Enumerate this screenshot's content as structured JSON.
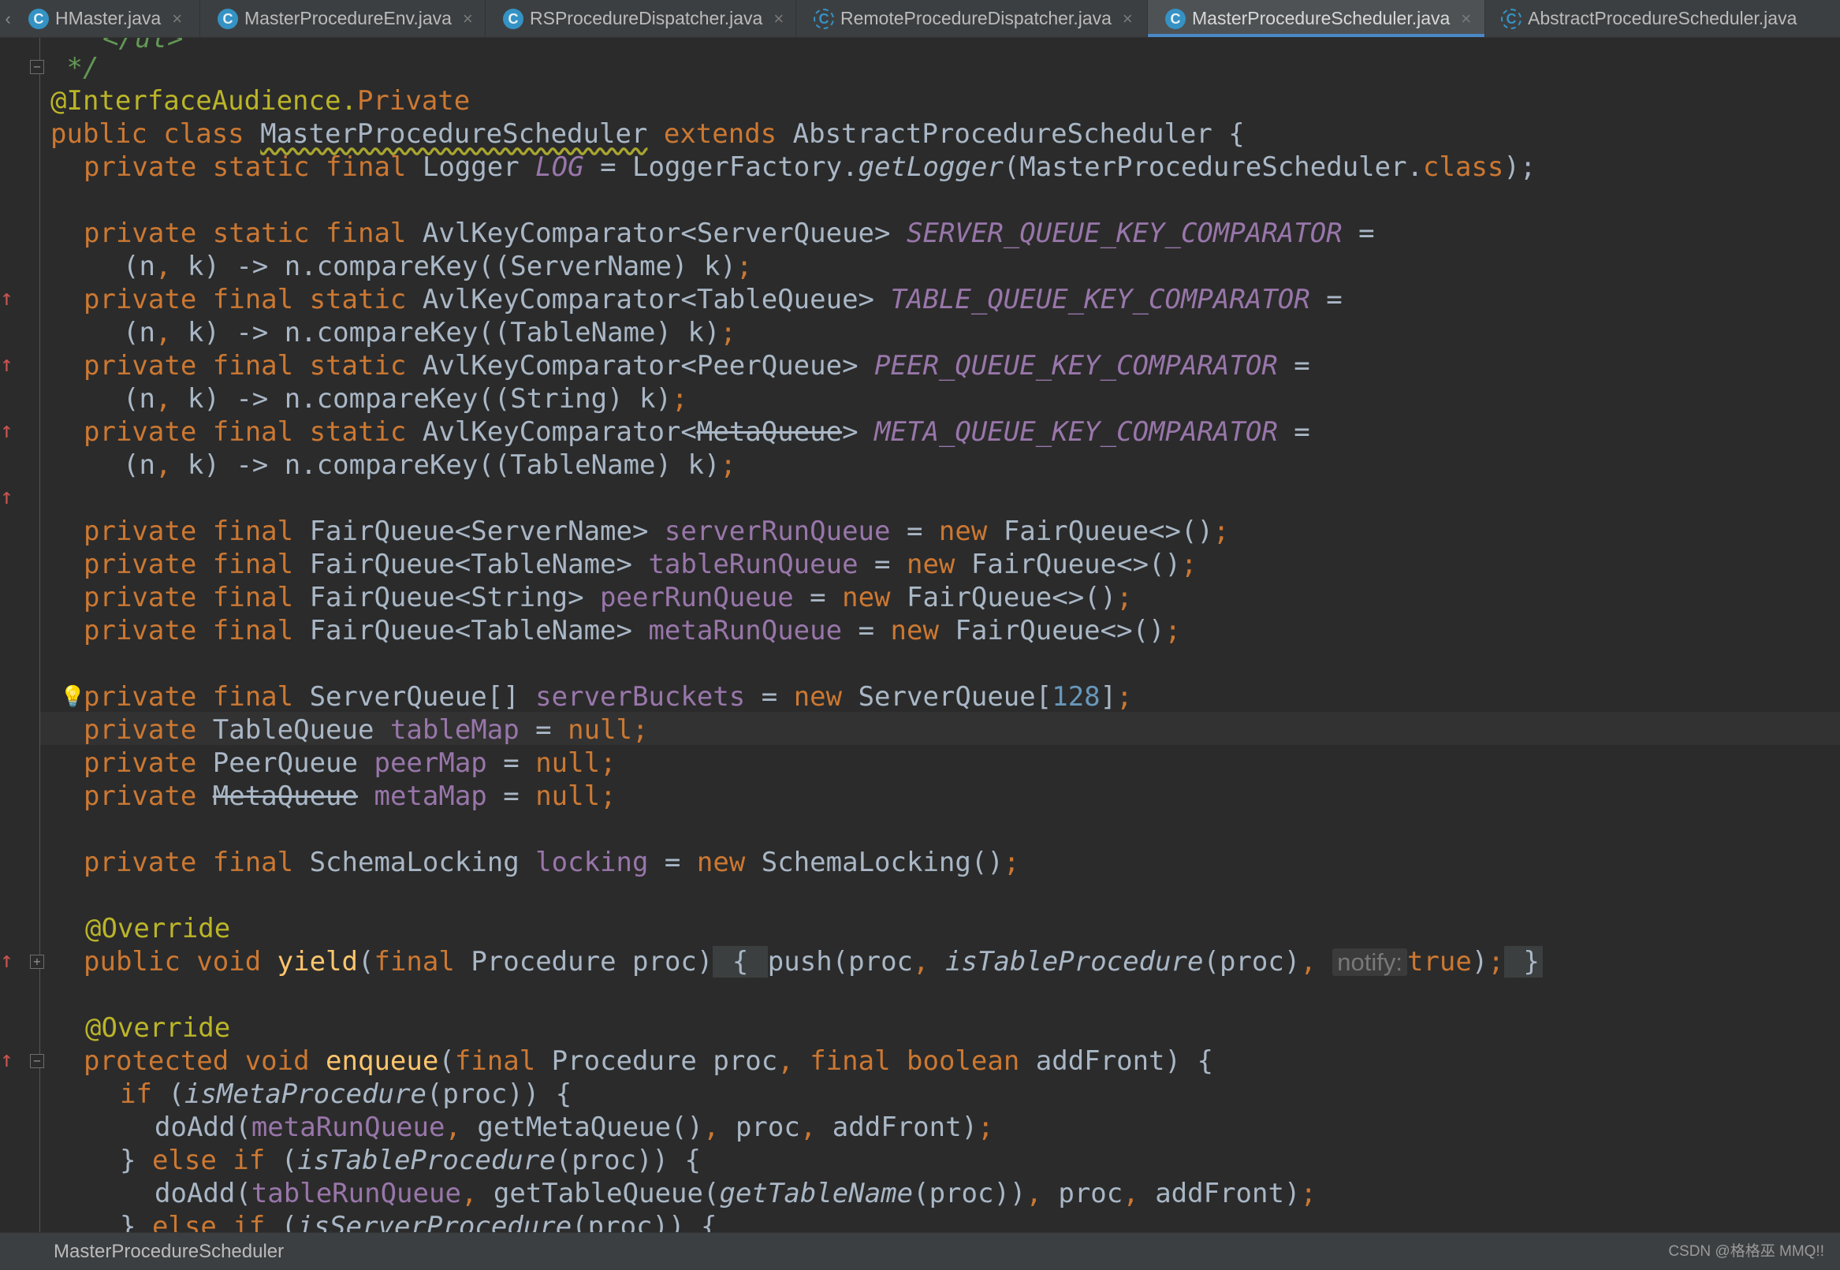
{
  "tabs": [
    {
      "label": "HMaster.java",
      "icon": "class-icon",
      "active": false
    },
    {
      "label": "MasterProcedureEnv.java",
      "icon": "class-icon",
      "active": false
    },
    {
      "label": "RSProcedureDispatcher.java",
      "icon": "class-icon",
      "active": false
    },
    {
      "label": "RemoteProcedureDispatcher.java",
      "icon": "abstract-class-icon",
      "active": false
    },
    {
      "label": "MasterProcedureScheduler.java",
      "icon": "class-icon",
      "active": true
    },
    {
      "label": "AbstractProcedureScheduler.java",
      "icon": "abstract-class-icon",
      "active": false
    }
  ],
  "tab_glyphs": {
    "class": "C",
    "close": "×",
    "edge": "‹"
  },
  "code": {
    "l0": {
      "t1": "</ul>"
    },
    "l1": {
      "t1": " */"
    },
    "l2": {
      "t1": "@InterfaceAudience.",
      "t2": "Private"
    },
    "l3": {
      "t1": "public class ",
      "t2": "MasterProcedureScheduler",
      "t3": " extends ",
      "t4": "AbstractProcedureScheduler {"
    },
    "l4": {
      "t1": "private static final ",
      "t2": "Logger ",
      "t3": "LOG",
      "t4": " = LoggerFactory.",
      "t5": "getLogger",
      "t6": "(MasterProcedureScheduler.",
      "t7": "class",
      "t8": ");"
    },
    "l6": {
      "t1": "private static final ",
      "t2": "AvlKeyComparator<ServerQueue> ",
      "t3": "SERVER_QUEUE_KEY_COMPARATOR",
      "t4": " ="
    },
    "l7": {
      "t1": "(n",
      "t2": ", ",
      "t3": "k) -> n.compareKey((ServerName) k)",
      "t4": ";"
    },
    "l8": {
      "t1": "private final static ",
      "t2": "AvlKeyComparator<TableQueue> ",
      "t3": "TABLE_QUEUE_KEY_COMPARATOR",
      "t4": " ="
    },
    "l9": {
      "t1": "(n",
      "t2": ", ",
      "t3": "k) -> n.compareKey((TableName) k)",
      "t4": ";"
    },
    "l10": {
      "t1": "private final static ",
      "t2": "AvlKeyComparator<PeerQueue> ",
      "t3": "PEER_QUEUE_KEY_COMPARATOR",
      "t4": " ="
    },
    "l11": {
      "t1": "(n",
      "t2": ", ",
      "t3": "k) -> n.compareKey((String) k)",
      "t4": ";"
    },
    "l12": {
      "t1": "private final static ",
      "t2": "AvlKeyComparator<",
      "t3": "MetaQueue",
      "t4": "> ",
      "t5": "META_QUEUE_KEY_COMPARATOR",
      "t6": " ="
    },
    "l13": {
      "t1": "(n",
      "t2": ", ",
      "t3": "k) -> n.compareKey((TableName) k)",
      "t4": ";"
    },
    "l15": {
      "t1": "private final ",
      "t2": "FairQueue<ServerName> ",
      "t3": "serverRunQueue",
      "t4": " = ",
      "t5": "new ",
      "t6": "FairQueue<>()",
      "t7": ";"
    },
    "l16": {
      "t1": "private final ",
      "t2": "FairQueue<TableName> ",
      "t3": "tableRunQueue",
      "t4": " = ",
      "t5": "new ",
      "t6": "FairQueue<>()",
      "t7": ";"
    },
    "l17": {
      "t1": "private final ",
      "t2": "FairQueue<String> ",
      "t3": "peerRunQueue",
      "t4": " = ",
      "t5": "new ",
      "t6": "FairQueue<>()",
      "t7": ";"
    },
    "l18": {
      "t1": "private final ",
      "t2": "FairQueue<TableName> ",
      "t3": "metaRunQueue",
      "t4": " = ",
      "t5": "new ",
      "t6": "FairQueue<>()",
      "t7": ";"
    },
    "l20": {
      "t1": "private final ",
      "t2": "ServerQueue[] ",
      "t3": "serverBuckets",
      "t4": " = ",
      "t5": "new ",
      "t6": "ServerQueue[",
      "t7": "128",
      "t8": "]",
      "t9": ";"
    },
    "l21": {
      "t1": "private ",
      "t2": "TableQueue ",
      "t3": "tableMap",
      "t4": " = ",
      "t5": "null;"
    },
    "l22": {
      "t1": "private ",
      "t2": "PeerQueue ",
      "t3": "peerMap",
      "t4": " = ",
      "t5": "null;"
    },
    "l23": {
      "t1": "private ",
      "t2": "MetaQueue",
      "t3": " ",
      "t4": "metaMap",
      "t5": " = ",
      "t6": "null;"
    },
    "l25": {
      "t1": "private final ",
      "t2": "SchemaLocking ",
      "t3": "locking",
      "t4": " = ",
      "t5": "new ",
      "t6": "SchemaLocking()",
      "t7": ";"
    },
    "l27": {
      "t1": "@Override"
    },
    "l28": {
      "t1": "public void ",
      "t2": "yield",
      "t3": "(",
      "t4": "final ",
      "t5": "Procedure proc)",
      "t6": " { ",
      "t7": "push(proc",
      "t8": ", ",
      "t9": "isTableProcedure",
      "t10": "(proc)",
      "t11": ", ",
      "t12": "notify:",
      "t13": "true",
      "t14": ")",
      "t15": ";",
      "t16": " }"
    },
    "l30": {
      "t1": "@Override"
    },
    "l31": {
      "t1": "protected void ",
      "t2": "enqueue",
      "t3": "(",
      "t4": "final ",
      "t5": "Procedure proc",
      "t6": ", ",
      "t7": "final boolean ",
      "t8": "addFront) {"
    },
    "l32": {
      "t1": "if ",
      "t2": "(",
      "t3": "isMetaProcedure",
      "t4": "(proc)) {"
    },
    "l33": {
      "t1": "doAdd(",
      "t2": "metaRunQueue",
      "t3": ", ",
      "t4": "getMetaQueue()",
      "t5": ", ",
      "t6": "proc",
      "t7": ", ",
      "t8": "addFront)",
      "t9": ";"
    },
    "l34": {
      "t1": "} ",
      "t2": "else if ",
      "t3": "(",
      "t4": "isTableProcedure",
      "t5": "(proc)) {"
    },
    "l35": {
      "t1": "doAdd(",
      "t2": "tableRunQueue",
      "t3": ", ",
      "t4": "getTableQueue(",
      "t5": "getTableName",
      "t6": "(proc))",
      "t7": ", ",
      "t8": "proc",
      "t9": ", ",
      "t10": "addFront)",
      "t11": ";"
    },
    "l36": {
      "t1": "} ",
      "t2": "else if ",
      "t3": "(",
      "t4": "isServerProcedure",
      "t5": "(proc)) {"
    }
  },
  "gutter_glyphs": {
    "arrow": "↑",
    "fold_open": "−",
    "fold_closed": "+",
    "bulb": "💡"
  },
  "status": {
    "breadcrumb": "MasterProcedureScheduler",
    "watermark": "CSDN @格格巫 MMQ!!"
  },
  "colors": {
    "background": "#2b2b2b",
    "keyword": "#cc7832",
    "annotation": "#bbb529",
    "field": "#9876aa",
    "method": "#ffc66d",
    "number": "#6897bb",
    "comment": "#629755",
    "text": "#a9b7c6",
    "active_tab_accent": "#4a88c7"
  }
}
